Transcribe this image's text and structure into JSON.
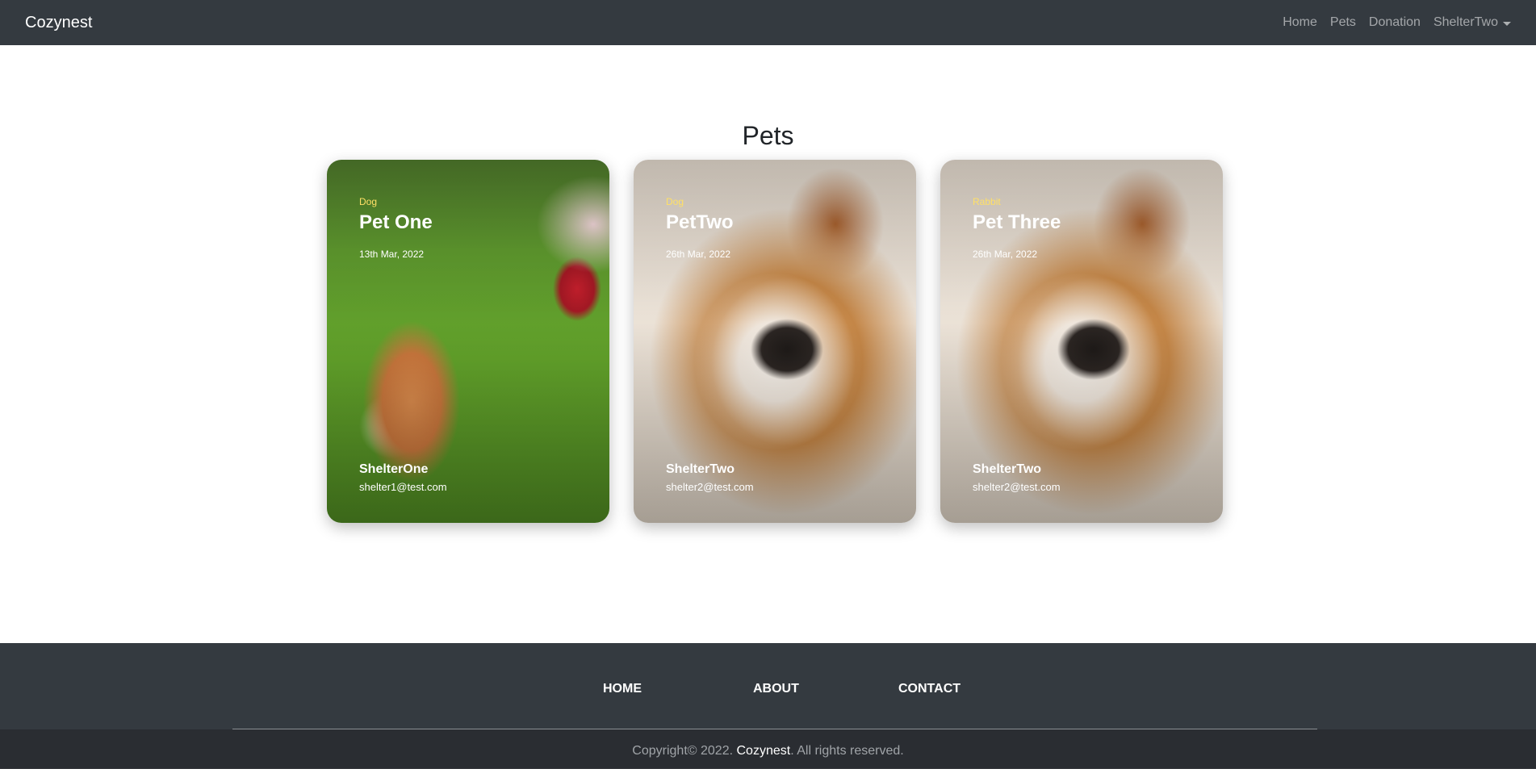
{
  "navbar": {
    "brand": "Cozynest",
    "links": [
      "Home",
      "Pets",
      "Donation"
    ],
    "user_menu": "ShelterTwo"
  },
  "main": {
    "title": "Pets",
    "cards": [
      {
        "type": "Dog",
        "name": "Pet One",
        "date": "13th Mar, 2022",
        "shelter": "ShelterOne",
        "email": "shelter1@test.com"
      },
      {
        "type": "Dog",
        "name": "PetTwo",
        "date": "26th Mar, 2022",
        "shelter": "ShelterTwo",
        "email": "shelter2@test.com"
      },
      {
        "type": "Rabbit",
        "name": "Pet Three",
        "date": "26th Mar, 2022",
        "shelter": "ShelterTwo",
        "email": "shelter2@test.com"
      }
    ]
  },
  "footer": {
    "links": [
      "HOME",
      "ABOUT",
      "CONTACT"
    ],
    "copyright_prefix": "Copyright© 2022.",
    "copyright_brand": "Cozynest",
    "copyright_suffix": ". All rights reserved."
  },
  "colors": {
    "navbar_bg": "#343a40",
    "footer_bg": "#343a40",
    "copyright_bg": "#2a2d32",
    "pet_type": "#ffe066"
  }
}
